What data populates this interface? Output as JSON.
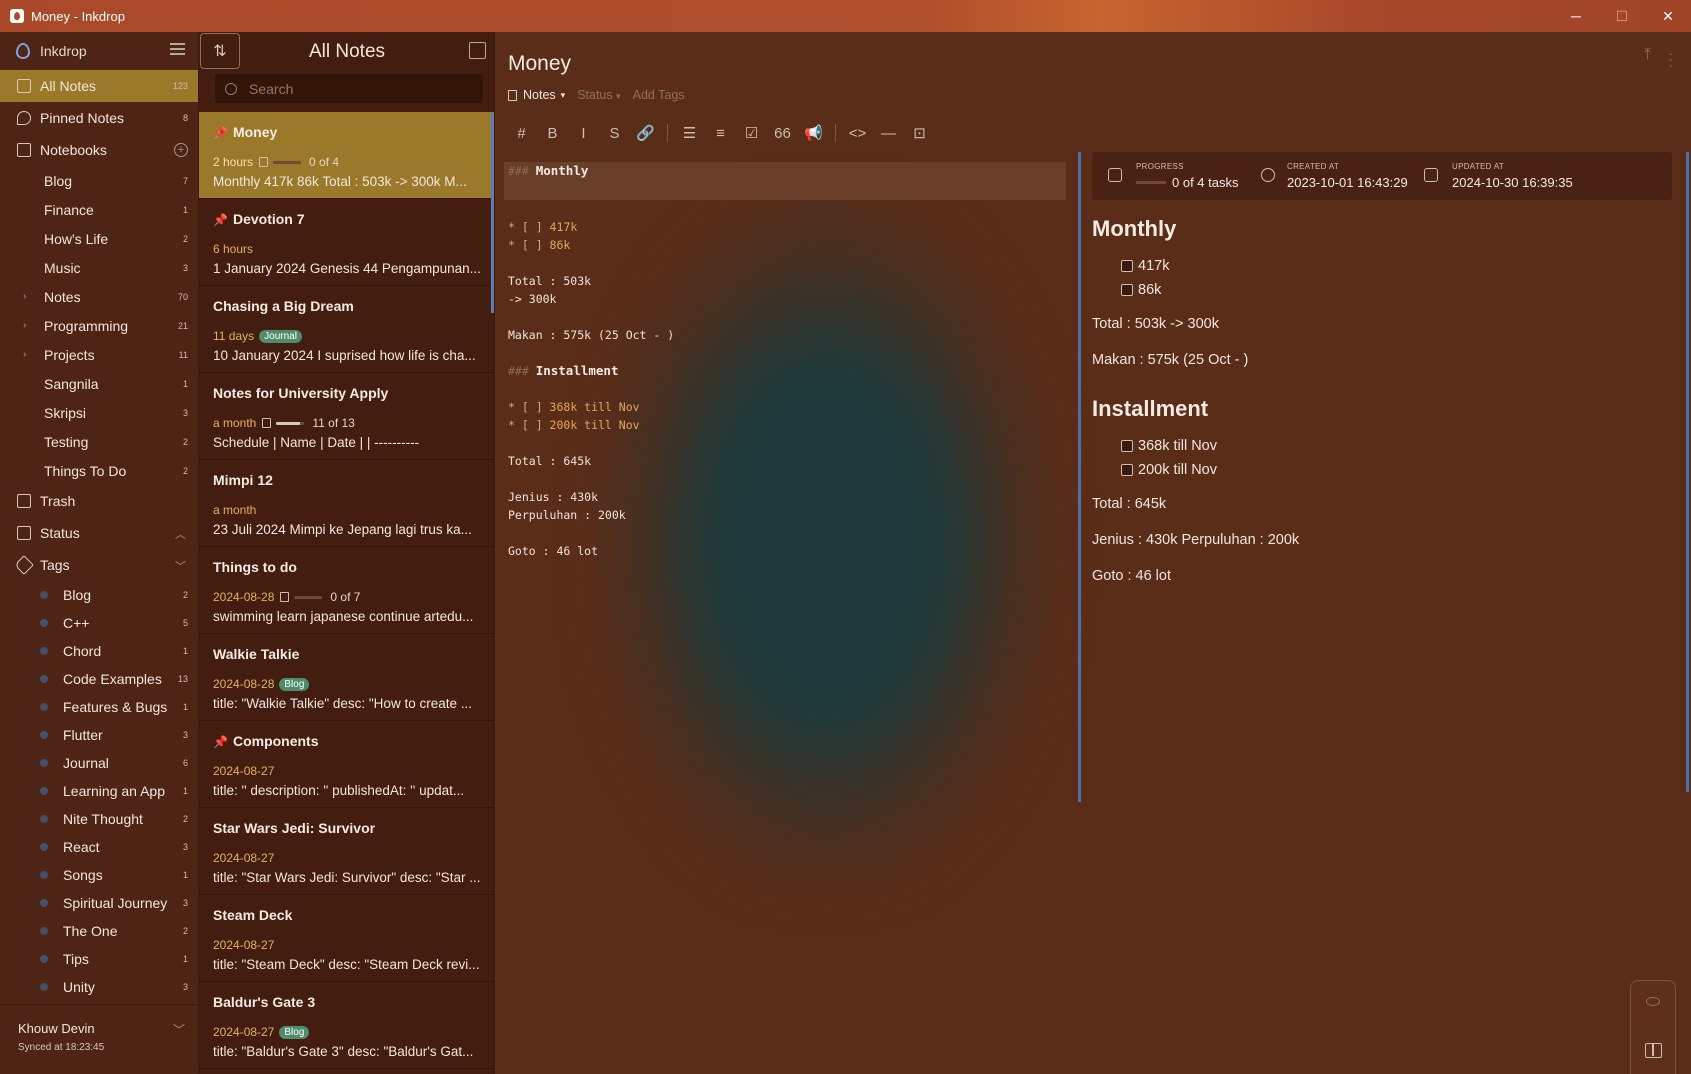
{
  "window": {
    "title": "Money - Inkdrop",
    "controls": {
      "minimize": "─",
      "maximize": "☐",
      "close": "✕"
    }
  },
  "sidebar": {
    "app_name": "Inkdrop",
    "all_notes": {
      "label": "All Notes",
      "count": "123"
    },
    "pinned": {
      "label": "Pinned Notes",
      "count": "8"
    },
    "notebooks_label": "Notebooks",
    "notebooks": [
      {
        "label": "Blog",
        "count": "7",
        "expandable": false
      },
      {
        "label": "Finance",
        "count": "1",
        "expandable": false
      },
      {
        "label": "How's Life",
        "count": "2",
        "expandable": false
      },
      {
        "label": "Music",
        "count": "3",
        "expandable": false
      },
      {
        "label": "Notes",
        "count": "70",
        "expandable": true
      },
      {
        "label": "Programming",
        "count": "21",
        "expandable": true
      },
      {
        "label": "Projects",
        "count": "11",
        "expandable": true
      },
      {
        "label": "Sangnila",
        "count": "1",
        "expandable": false
      },
      {
        "label": "Skripsi",
        "count": "3",
        "expandable": false
      },
      {
        "label": "Testing",
        "count": "2",
        "expandable": false
      },
      {
        "label": "Things To Do",
        "count": "2",
        "expandable": false
      }
    ],
    "trash_label": "Trash",
    "status_label": "Status",
    "tags_label": "Tags",
    "tags": [
      {
        "label": "Blog",
        "count": "2"
      },
      {
        "label": "C++",
        "count": "5"
      },
      {
        "label": "Chord",
        "count": "1"
      },
      {
        "label": "Code Examples",
        "count": "13"
      },
      {
        "label": "Features & Bugs",
        "count": "1"
      },
      {
        "label": "Flutter",
        "count": "3"
      },
      {
        "label": "Journal",
        "count": "6"
      },
      {
        "label": "Learning an App",
        "count": "1"
      },
      {
        "label": "Nite Thought",
        "count": "2"
      },
      {
        "label": "React",
        "count": "3"
      },
      {
        "label": "Songs",
        "count": "1"
      },
      {
        "label": "Spiritual Journey",
        "count": "3"
      },
      {
        "label": "The One",
        "count": "2"
      },
      {
        "label": "Tips",
        "count": "1"
      },
      {
        "label": "Unity",
        "count": "3"
      }
    ],
    "footer": {
      "user": "Khouw Devin",
      "sync": "Synced at 18:23:45"
    }
  },
  "note_list": {
    "title": "All Notes",
    "search_placeholder": "Search",
    "notes": [
      {
        "title": "Money",
        "pinned": true,
        "time": "2 hours",
        "progress": "0 of 4",
        "progress_fraction": 0,
        "badge": "",
        "body": "Monthly 417k 86k Total : 503k -> 300k M...",
        "selected": true
      },
      {
        "title": "Devotion 7",
        "pinned": true,
        "time": "6 hours",
        "progress": "",
        "progress_fraction": 0,
        "badge": "",
        "body": "1 January 2024 Genesis 44 Pengampunan...",
        "selected": false
      },
      {
        "title": "Chasing a Big Dream",
        "pinned": false,
        "time": "11 days",
        "progress": "",
        "progress_fraction": 0,
        "badge": "Journal",
        "body": "10 January 2024 I suprised how life is cha...",
        "selected": false
      },
      {
        "title": "Notes for University Apply",
        "pinned": false,
        "time": "a month",
        "progress": "11 of 13",
        "progress_fraction": 0.85,
        "badge": "",
        "body": "Schedule | Name | Date | | ----------",
        "selected": false
      },
      {
        "title": "Mimpi 12",
        "pinned": false,
        "time": "a month",
        "progress": "",
        "progress_fraction": 0,
        "badge": "",
        "body": "23 Juli 2024 Mimpi ke Jepang lagi trus ka...",
        "selected": false
      },
      {
        "title": "Things to do",
        "pinned": false,
        "time": "2024-08-28",
        "progress": "0 of 7",
        "progress_fraction": 0,
        "badge": "",
        "body": "swimming learn japanese continue artedu...",
        "selected": false
      },
      {
        "title": "Walkie Talkie",
        "pinned": false,
        "time": "2024-08-28",
        "progress": "",
        "progress_fraction": 0,
        "badge": "Blog",
        "body": "title: \"Walkie Talkie\" desc: \"How to create ...",
        "selected": false
      },
      {
        "title": "Components",
        "pinned": true,
        "time": "2024-08-27",
        "progress": "",
        "progress_fraction": 0,
        "badge": "",
        "body": "title: '' description: '' publishedAt: '' updat...",
        "selected": false
      },
      {
        "title": "Star Wars Jedi: Survivor",
        "pinned": false,
        "time": "2024-08-27",
        "progress": "",
        "progress_fraction": 0,
        "badge": "",
        "body": "title: \"Star Wars Jedi: Survivor\" desc: \"Star ...",
        "selected": false
      },
      {
        "title": "Steam Deck",
        "pinned": false,
        "time": "2024-08-27",
        "progress": "",
        "progress_fraction": 0,
        "badge": "",
        "body": "title: \"Steam Deck\" desc: \"Steam Deck revi...",
        "selected": false
      },
      {
        "title": "Baldur's Gate 3",
        "pinned": false,
        "time": "2024-08-27",
        "progress": "",
        "progress_fraction": 0,
        "badge": "Blog",
        "body": "title: \"Baldur's Gate 3\" desc: \"Baldur's Gat...",
        "selected": false
      }
    ]
  },
  "editor": {
    "title": "Money",
    "notebook": "Notes",
    "status_placeholder": "Status",
    "tags_placeholder": "Add Tags",
    "toolbar": [
      "#",
      "B",
      "I",
      "S",
      "🔗",
      "☰",
      "≡",
      "☑",
      "66",
      "📢",
      "<>",
      "—",
      "⊡"
    ],
    "source_lines": [
      {
        "kind": "header",
        "prefix": "### ",
        "text": "Monthly"
      },
      {
        "kind": "blank",
        "text": ""
      },
      {
        "kind": "task",
        "prefix": "* [ ] ",
        "text": "417k"
      },
      {
        "kind": "task",
        "prefix": "* [ ] ",
        "text": "86k"
      },
      {
        "kind": "blank",
        "text": ""
      },
      {
        "kind": "plain",
        "text": "Total : 503k"
      },
      {
        "kind": "plain",
        "text": "-> 300k"
      },
      {
        "kind": "blank",
        "text": ""
      },
      {
        "kind": "plain",
        "text": "Makan : 575k (25 Oct - )"
      },
      {
        "kind": "blank",
        "text": ""
      },
      {
        "kind": "header",
        "prefix": "### ",
        "text": "Installment"
      },
      {
        "kind": "blank",
        "text": ""
      },
      {
        "kind": "task",
        "prefix": "* [ ] ",
        "text": "368k till Nov"
      },
      {
        "kind": "task",
        "prefix": "* [ ] ",
        "text": "200k till Nov"
      },
      {
        "kind": "blank",
        "text": ""
      },
      {
        "kind": "plain",
        "text": "Total : 645k"
      },
      {
        "kind": "blank",
        "text": ""
      },
      {
        "kind": "plain",
        "text": "Jenius : 430k"
      },
      {
        "kind": "plain",
        "text": "Perpuluhan : 200k"
      },
      {
        "kind": "blank",
        "text": ""
      },
      {
        "kind": "plain",
        "text": "Goto : 46 lot"
      }
    ]
  },
  "preview": {
    "progress_label": "PROGRESS",
    "progress_value": "0 of 4 tasks",
    "created_label": "CREATED AT",
    "created_value": "2023-10-01 16:43:29",
    "updated_label": "UPDATED AT",
    "updated_value": "2024-10-30 16:39:35",
    "heading1": "Monthly",
    "tasks1": [
      "417k",
      "86k"
    ],
    "p1": "Total : 503k -> 300k",
    "p2": "Makan : 575k (25 Oct - )",
    "heading2": "Installment",
    "tasks2": [
      "368k till Nov",
      "200k till Nov"
    ],
    "p3": "Total : 645k",
    "p4": "Jenius : 430k Perpuluhan : 200k",
    "p5": "Goto : 46 lot"
  },
  "colors": {
    "accent": "#9a7a2a",
    "titlebar": "#a9492a",
    "tag_badge": "#4f8c6a",
    "task_text": "#e0a85a",
    "scroll_indicator": "#4f6fa8"
  }
}
